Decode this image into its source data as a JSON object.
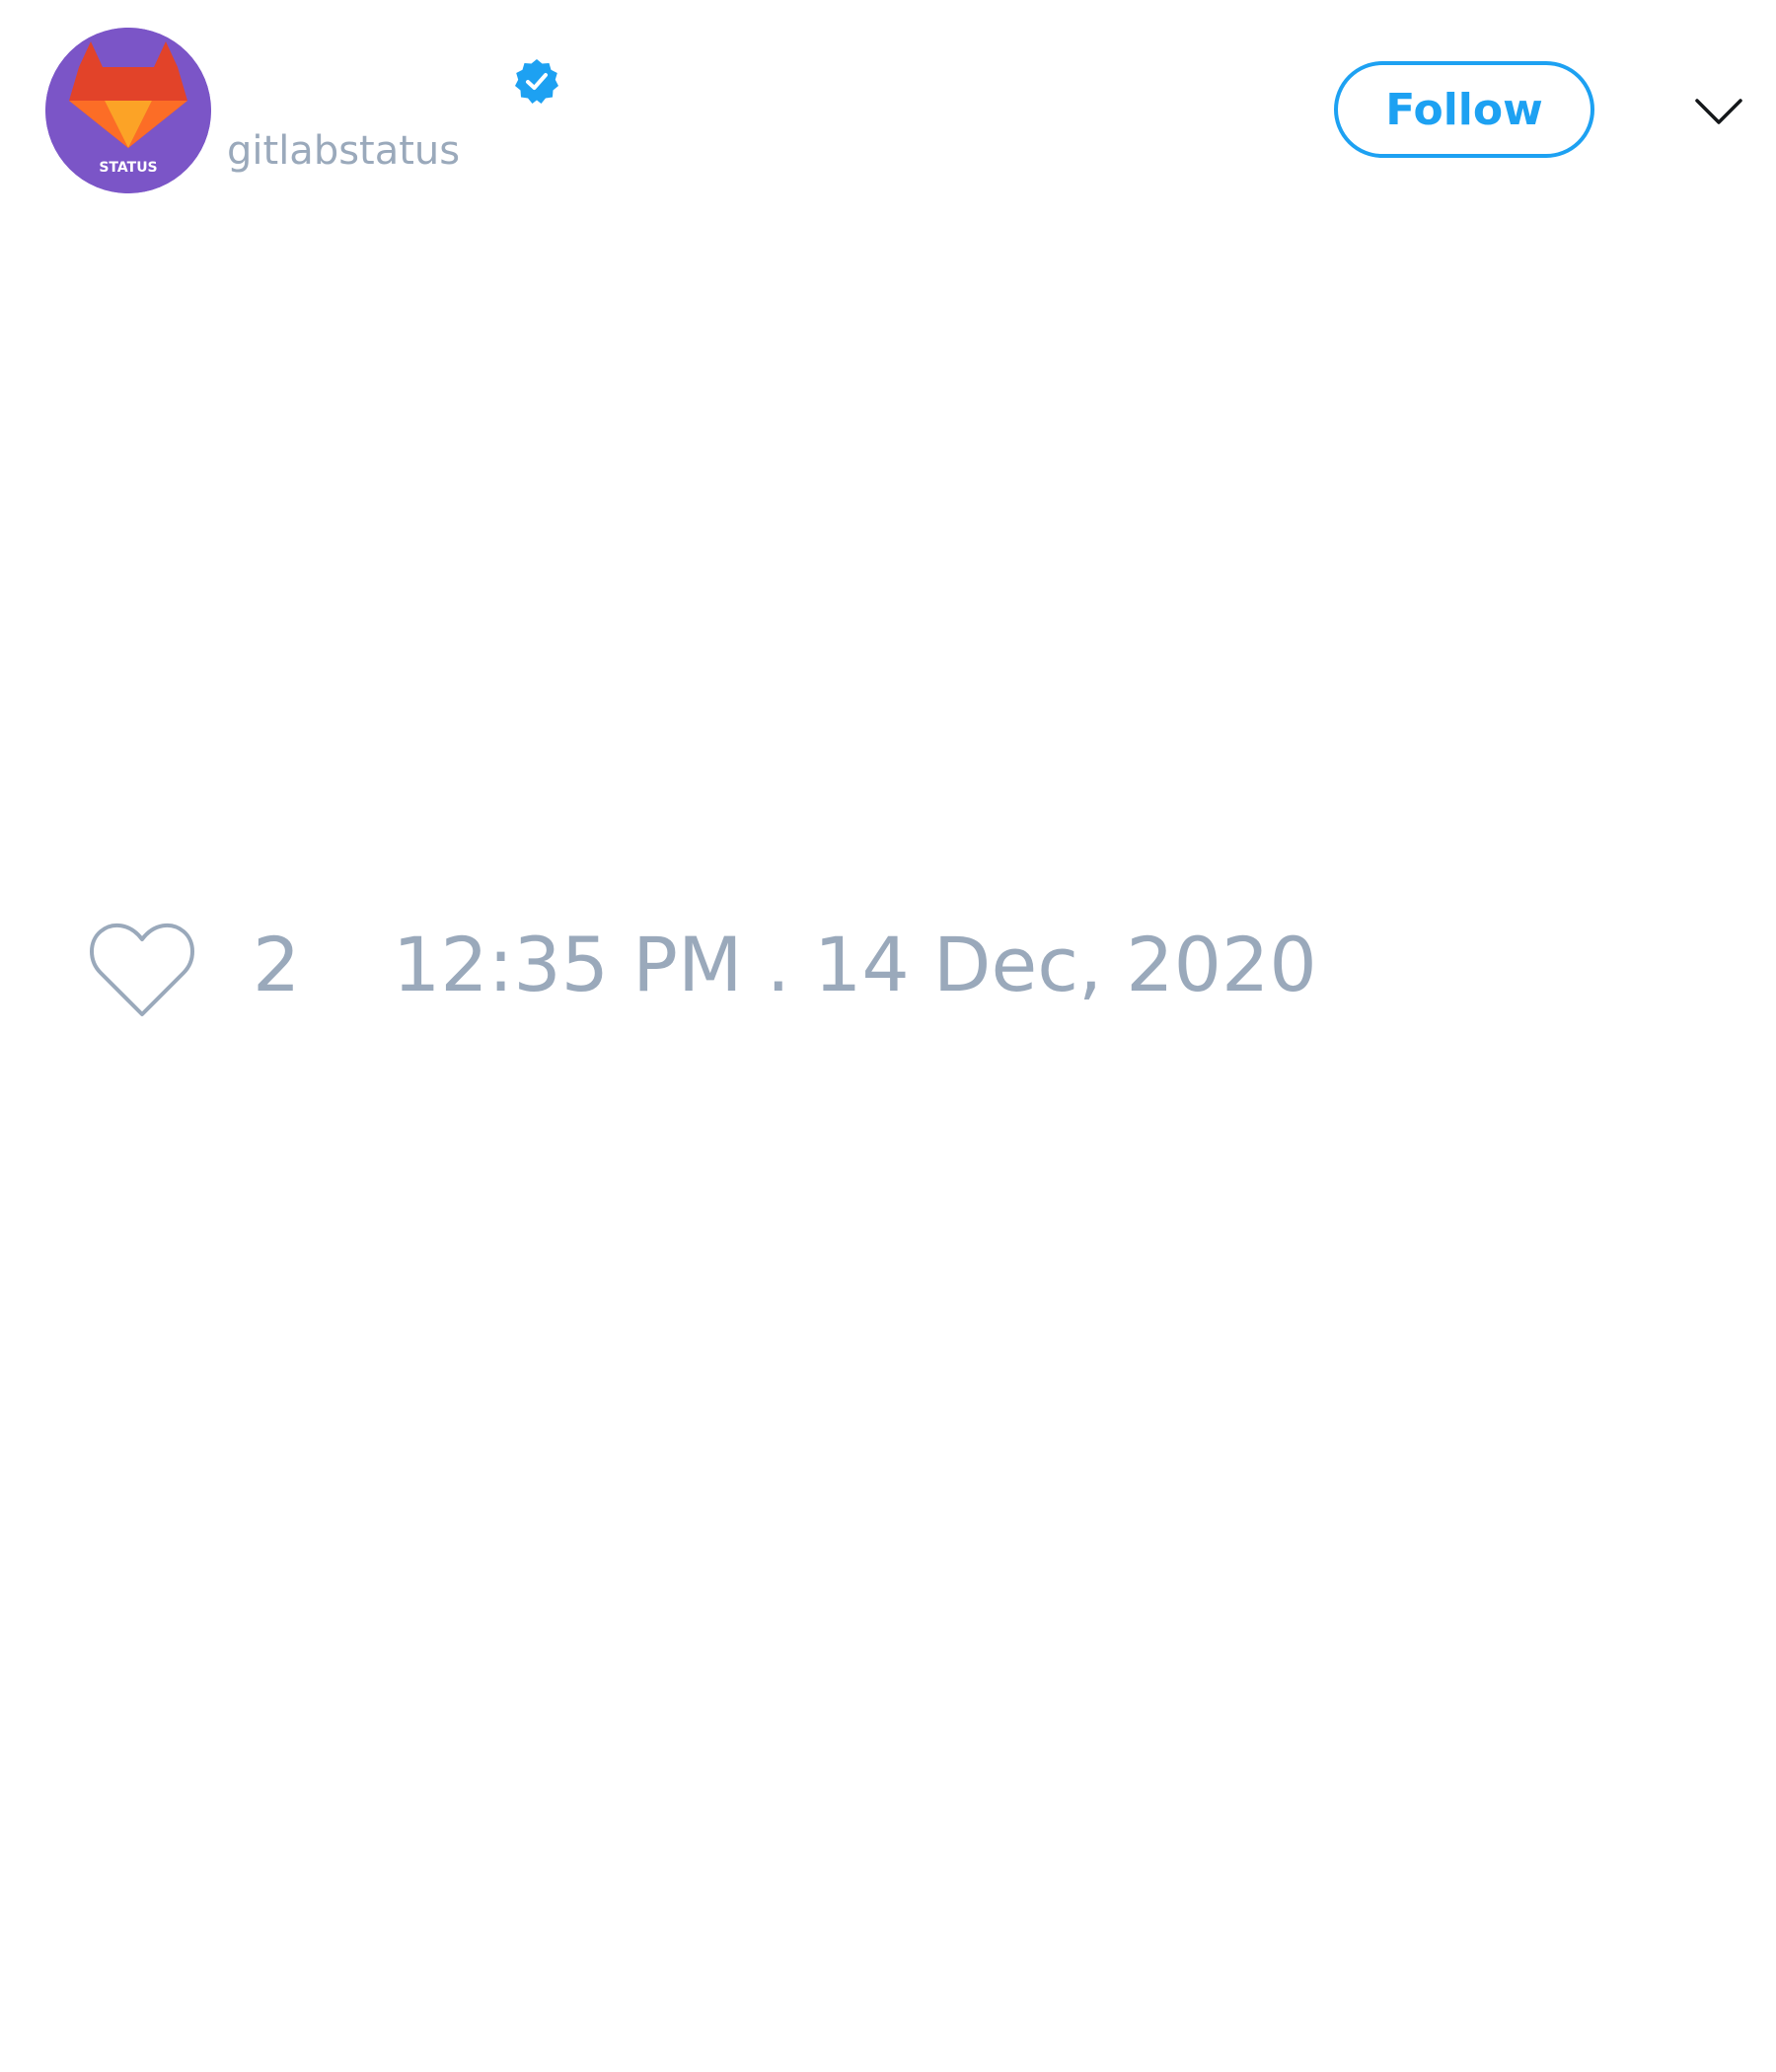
{
  "header": {
    "display_name": "",
    "handle": "gitlabstatus",
    "avatar_icon": "gitlab-status-logo-icon",
    "avatar_text": "STATUS",
    "verified_icon": "verified-badge-icon",
    "follow_label": "Follow",
    "more_icon": "chevron-down-icon"
  },
  "footer": {
    "like_icon": "heart-icon",
    "like_count": "2",
    "timestamp": "12:35 PM . 14 Dec, 2020"
  },
  "colors": {
    "accent": "#1da1f2",
    "muted_text": "#9aa9bb",
    "avatar_bg": "#7b55c7",
    "background": "#ffffff"
  }
}
